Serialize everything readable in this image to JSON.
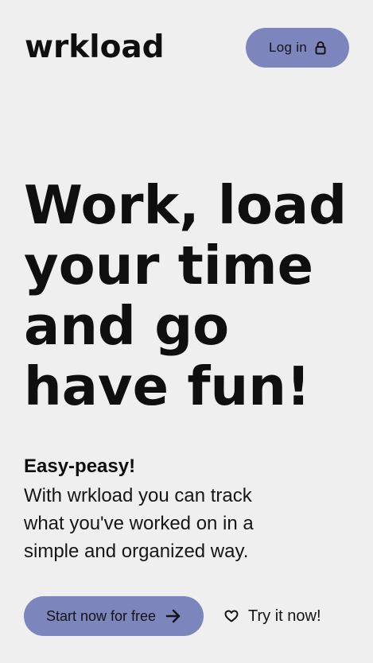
{
  "header": {
    "logo_text": "wrkload",
    "login_label": "Log in",
    "login_icon": "lock-icon"
  },
  "hero": {
    "title_lines": [
      "Work, load",
      "your time",
      "and go",
      "have fun!"
    ],
    "subtitle": "Easy-peasy!",
    "description_lines": [
      "With wrkload you can track",
      "what you've worked on in a",
      "simple and organized way."
    ]
  },
  "cta": {
    "start_label": "Start now for free",
    "start_icon": "arrow-right-icon",
    "try_label": "Try it now!",
    "try_icon": "heart-icon"
  },
  "colors": {
    "background": "#efefef",
    "accent": "#7c86bd",
    "text": "#0f0f0f"
  }
}
